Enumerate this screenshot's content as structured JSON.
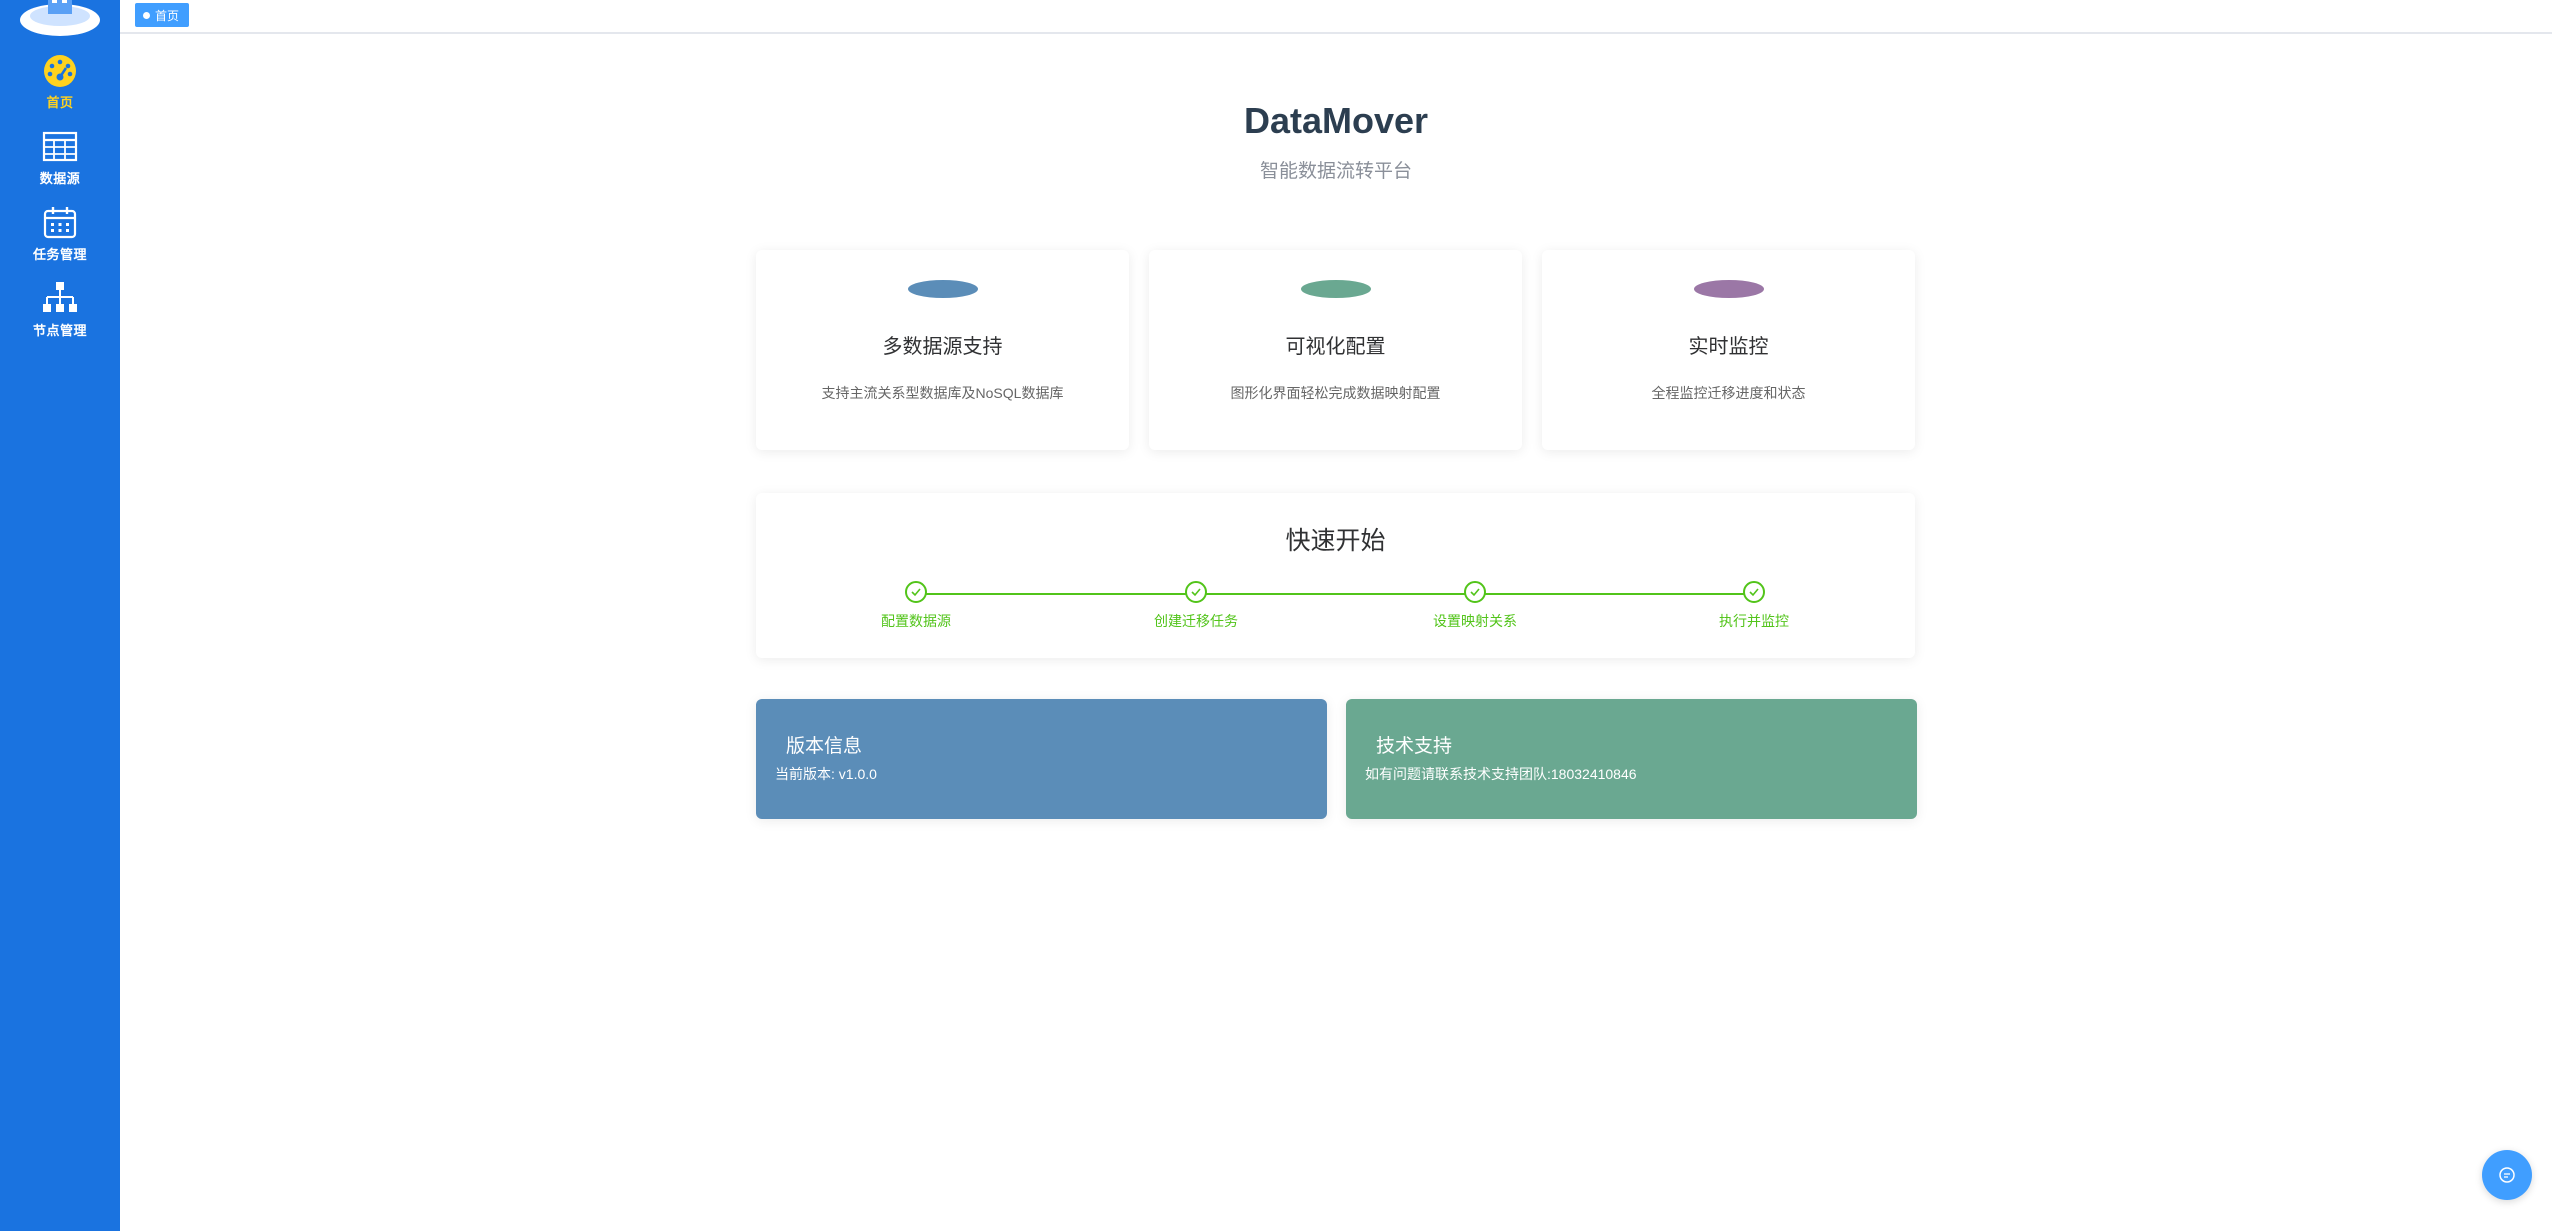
{
  "sidebar": {
    "items": [
      {
        "label": "首页",
        "icon": "dashboard-gauge-icon",
        "active": true
      },
      {
        "label": "数据源",
        "icon": "table-grid-icon",
        "active": false
      },
      {
        "label": "任务管理",
        "icon": "calendar-icon",
        "active": false
      },
      {
        "label": "节点管理",
        "icon": "org-tree-icon",
        "active": false
      }
    ]
  },
  "tags": [
    {
      "label": "首页",
      "active": true
    }
  ],
  "hero": {
    "title": "DataMover",
    "subtitle": "智能数据流转平台"
  },
  "features": [
    {
      "title": "多数据源支持",
      "desc": "支持主流关系型数据库及NoSQL数据库",
      "color": "#5b8db8"
    },
    {
      "title": "可视化配置",
      "desc": "图形化界面轻松完成数据映射配置",
      "color": "#6aa891"
    },
    {
      "title": "实时监控",
      "desc": "全程监控迁移进度和状态",
      "color": "#9b77a6"
    }
  ],
  "quick_start": {
    "title": "快速开始",
    "steps": [
      "配置数据源",
      "创建迁移任务",
      "设置映射关系",
      "执行并监控"
    ],
    "color": "#52c41a"
  },
  "info_cards": [
    {
      "title": "版本信息",
      "text": "当前版本: v1.0.0",
      "color": "#5b8db8"
    },
    {
      "title": "技术支持",
      "text": "如有问题请联系技术支持团队:18032410846",
      "color": "#6aa891"
    }
  ],
  "colors": {
    "sidebar": "#1a73e0",
    "active_nav": "#ffd21f",
    "accent": "#409eff"
  }
}
